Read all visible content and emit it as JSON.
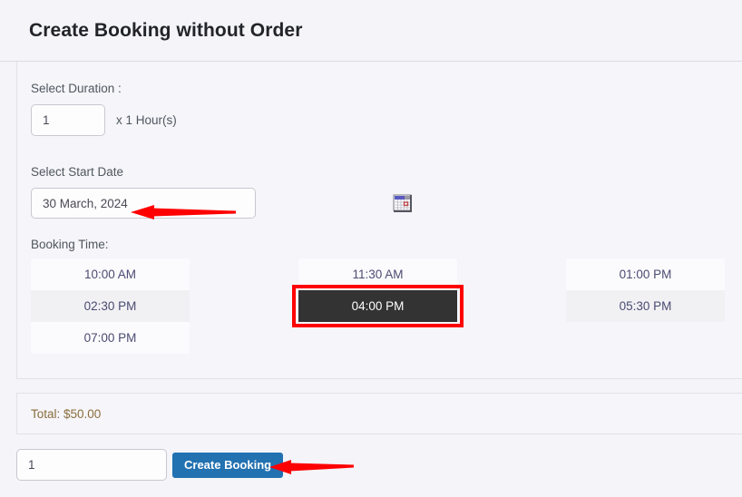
{
  "header": {
    "title": "Create Booking without Order"
  },
  "form": {
    "duration": {
      "label": "Select Duration :",
      "value": "1",
      "suffix": "x 1 Hour(s)"
    },
    "start_date": {
      "label": "Select Start Date",
      "value": "30 March, 2024",
      "calendar_icon": "calendar-icon"
    },
    "booking_time": {
      "label": "Booking Time:",
      "columns": [
        [
          {
            "time": "10:00 AM",
            "selected": false
          },
          {
            "time": "02:30 PM",
            "selected": false
          },
          {
            "time": "07:00 PM",
            "selected": false
          }
        ],
        [
          {
            "time": "11:30 AM",
            "selected": false
          },
          {
            "time": "04:00 PM",
            "selected": true
          }
        ],
        [
          {
            "time": "01:00 PM",
            "selected": false
          },
          {
            "time": "05:30 PM",
            "selected": false
          }
        ]
      ]
    }
  },
  "total": {
    "text": "Total: $50.00"
  },
  "footer": {
    "quantity_value": "1",
    "create_booking_label": "Create Booking"
  },
  "annotations": {
    "arrow_date": "red-arrow-left-icon",
    "arrow_button": "red-arrow-left-icon",
    "arrow_color": "#ff0000",
    "selection_outline_color": "#ff0000"
  },
  "colors": {
    "page_background": "#f4f4f9",
    "panel_background": "#f5f5fa",
    "primary_button": "#2271b1",
    "selected_slot": "#333333",
    "total_text": "#8a6d3b"
  }
}
